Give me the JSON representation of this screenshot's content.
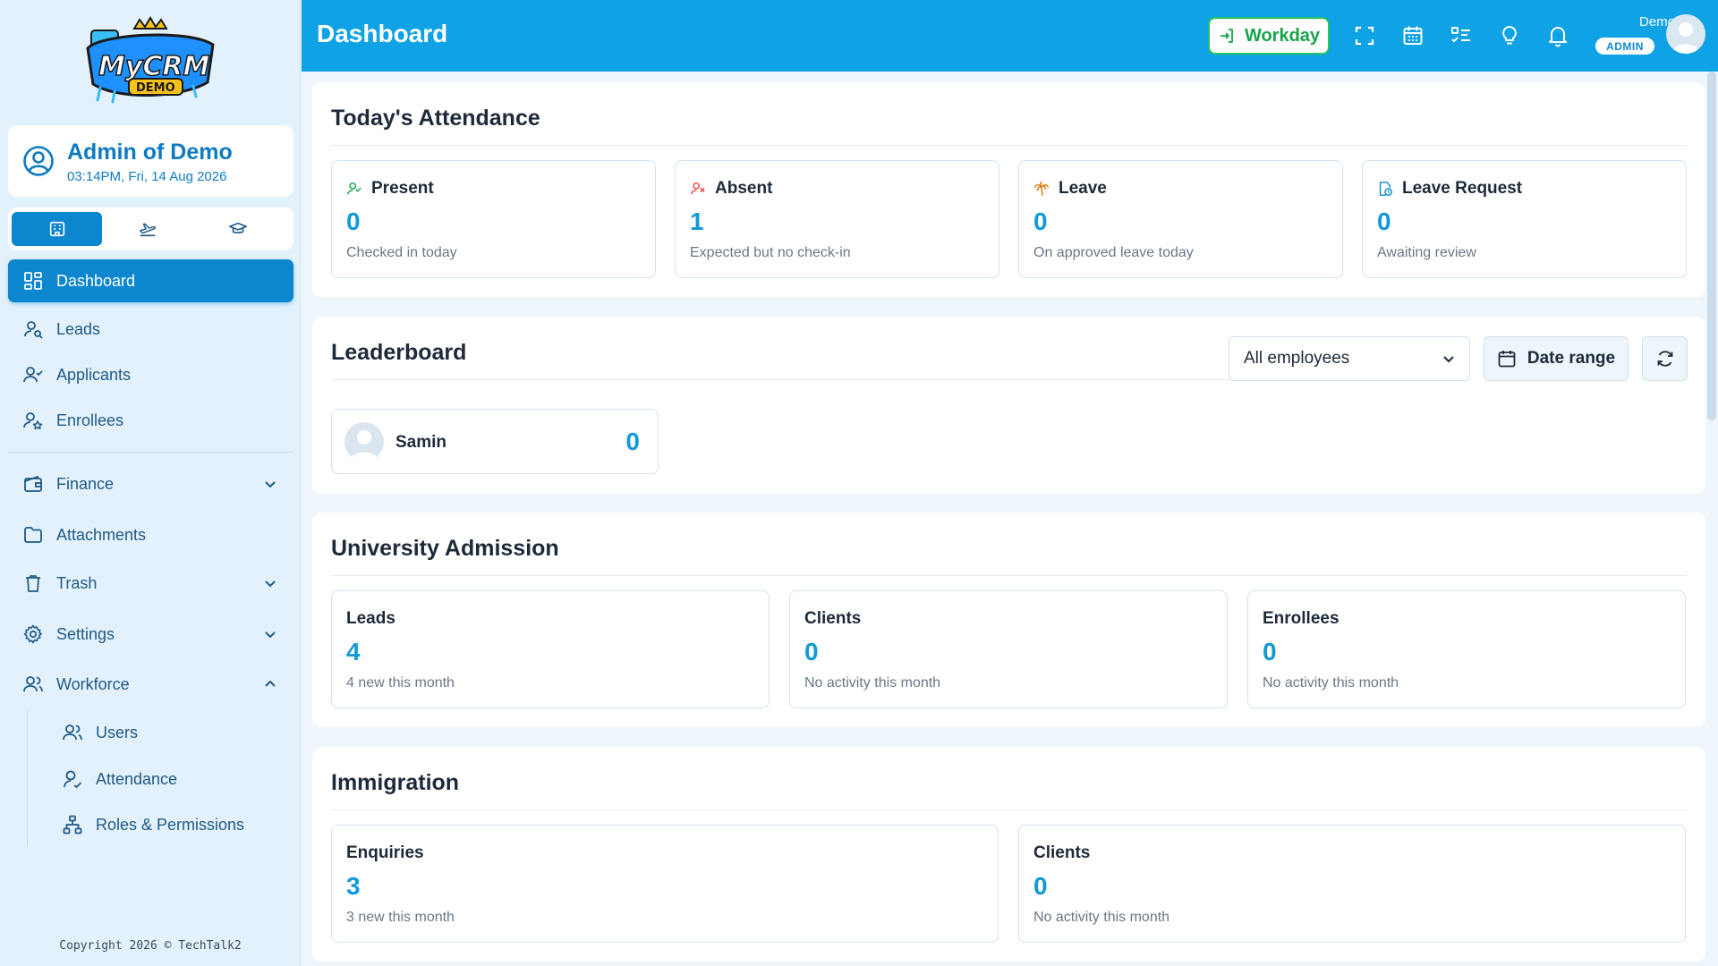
{
  "app": {
    "logo_text": "MyCRM DEMO",
    "copyright": "Copyright 2026 © TechTalk2"
  },
  "user_card": {
    "name": "Admin of Demo",
    "datetime": "03:14PM, Fri, 14 Aug 2026"
  },
  "mode_switch": {
    "buttons": [
      {
        "icon": "building-icon",
        "active": true
      },
      {
        "icon": "plane-icon",
        "active": false
      },
      {
        "icon": "graduation-cap-icon",
        "active": false
      }
    ]
  },
  "sidebar": {
    "items": [
      {
        "label": "Dashboard",
        "icon": "dashboard-grid-icon",
        "active": true
      },
      {
        "label": "Leads",
        "icon": "user-search-icon"
      },
      {
        "label": "Applicants",
        "icon": "user-check-icon"
      },
      {
        "label": "Enrollees",
        "icon": "user-star-icon"
      },
      {
        "label": "Finance",
        "icon": "wallet-icon",
        "expandable": true,
        "expanded": false
      },
      {
        "label": "Attachments",
        "icon": "folder-icon"
      },
      {
        "label": "Trash",
        "icon": "trash-icon",
        "expandable": true,
        "expanded": false
      },
      {
        "label": "Settings",
        "icon": "gear-icon",
        "expandable": true,
        "expanded": false
      },
      {
        "label": "Workforce",
        "icon": "users-icon",
        "expandable": true,
        "expanded": true
      }
    ],
    "workforce_sub": [
      {
        "label": "Users",
        "icon": "users-icon"
      },
      {
        "label": "Attendance",
        "icon": "user-check-icon"
      },
      {
        "label": "Roles & Permissions",
        "icon": "hierarchy-icon"
      }
    ]
  },
  "header": {
    "title": "Dashboard",
    "workday_label": "Workday",
    "icons": [
      "fullscreen-icon",
      "calendar-icon",
      "checklist-icon",
      "lightbulb-icon",
      "bell-icon"
    ],
    "user_name": "Demo",
    "user_role": "ADMIN"
  },
  "attendance": {
    "title": "Today's Attendance",
    "cards": [
      {
        "label": "Present",
        "value": "0",
        "sub": "Checked in today",
        "icon": "user-check-icon",
        "color": "#16a34a"
      },
      {
        "label": "Absent",
        "value": "1",
        "sub": "Expected but no check-in",
        "icon": "user-x-icon",
        "color": "#ef4444"
      },
      {
        "label": "Leave",
        "value": "0",
        "sub": "On approved leave today",
        "icon": "palm-tree-icon",
        "color": "#d97706"
      },
      {
        "label": "Leave Request",
        "value": "0",
        "sub": "Awaiting review",
        "icon": "file-clock-icon",
        "color": "#0e8ad0"
      }
    ]
  },
  "leaderboard": {
    "title": "Leaderboard",
    "filter_value": "All employees",
    "date_range_label": "Date range",
    "entries": [
      {
        "name": "Samin",
        "score": "0"
      }
    ]
  },
  "university": {
    "title": "University Admission",
    "cards": [
      {
        "label": "Leads",
        "value": "4",
        "sub": "4 new this month"
      },
      {
        "label": "Clients",
        "value": "0",
        "sub": "No activity this month"
      },
      {
        "label": "Enrollees",
        "value": "0",
        "sub": "No activity this month"
      }
    ]
  },
  "immigration": {
    "title": "Immigration",
    "cards": [
      {
        "label": "Enquiries",
        "value": "3",
        "sub": "3 new this month"
      },
      {
        "label": "Clients",
        "value": "0",
        "sub": "No activity this month"
      }
    ]
  }
}
